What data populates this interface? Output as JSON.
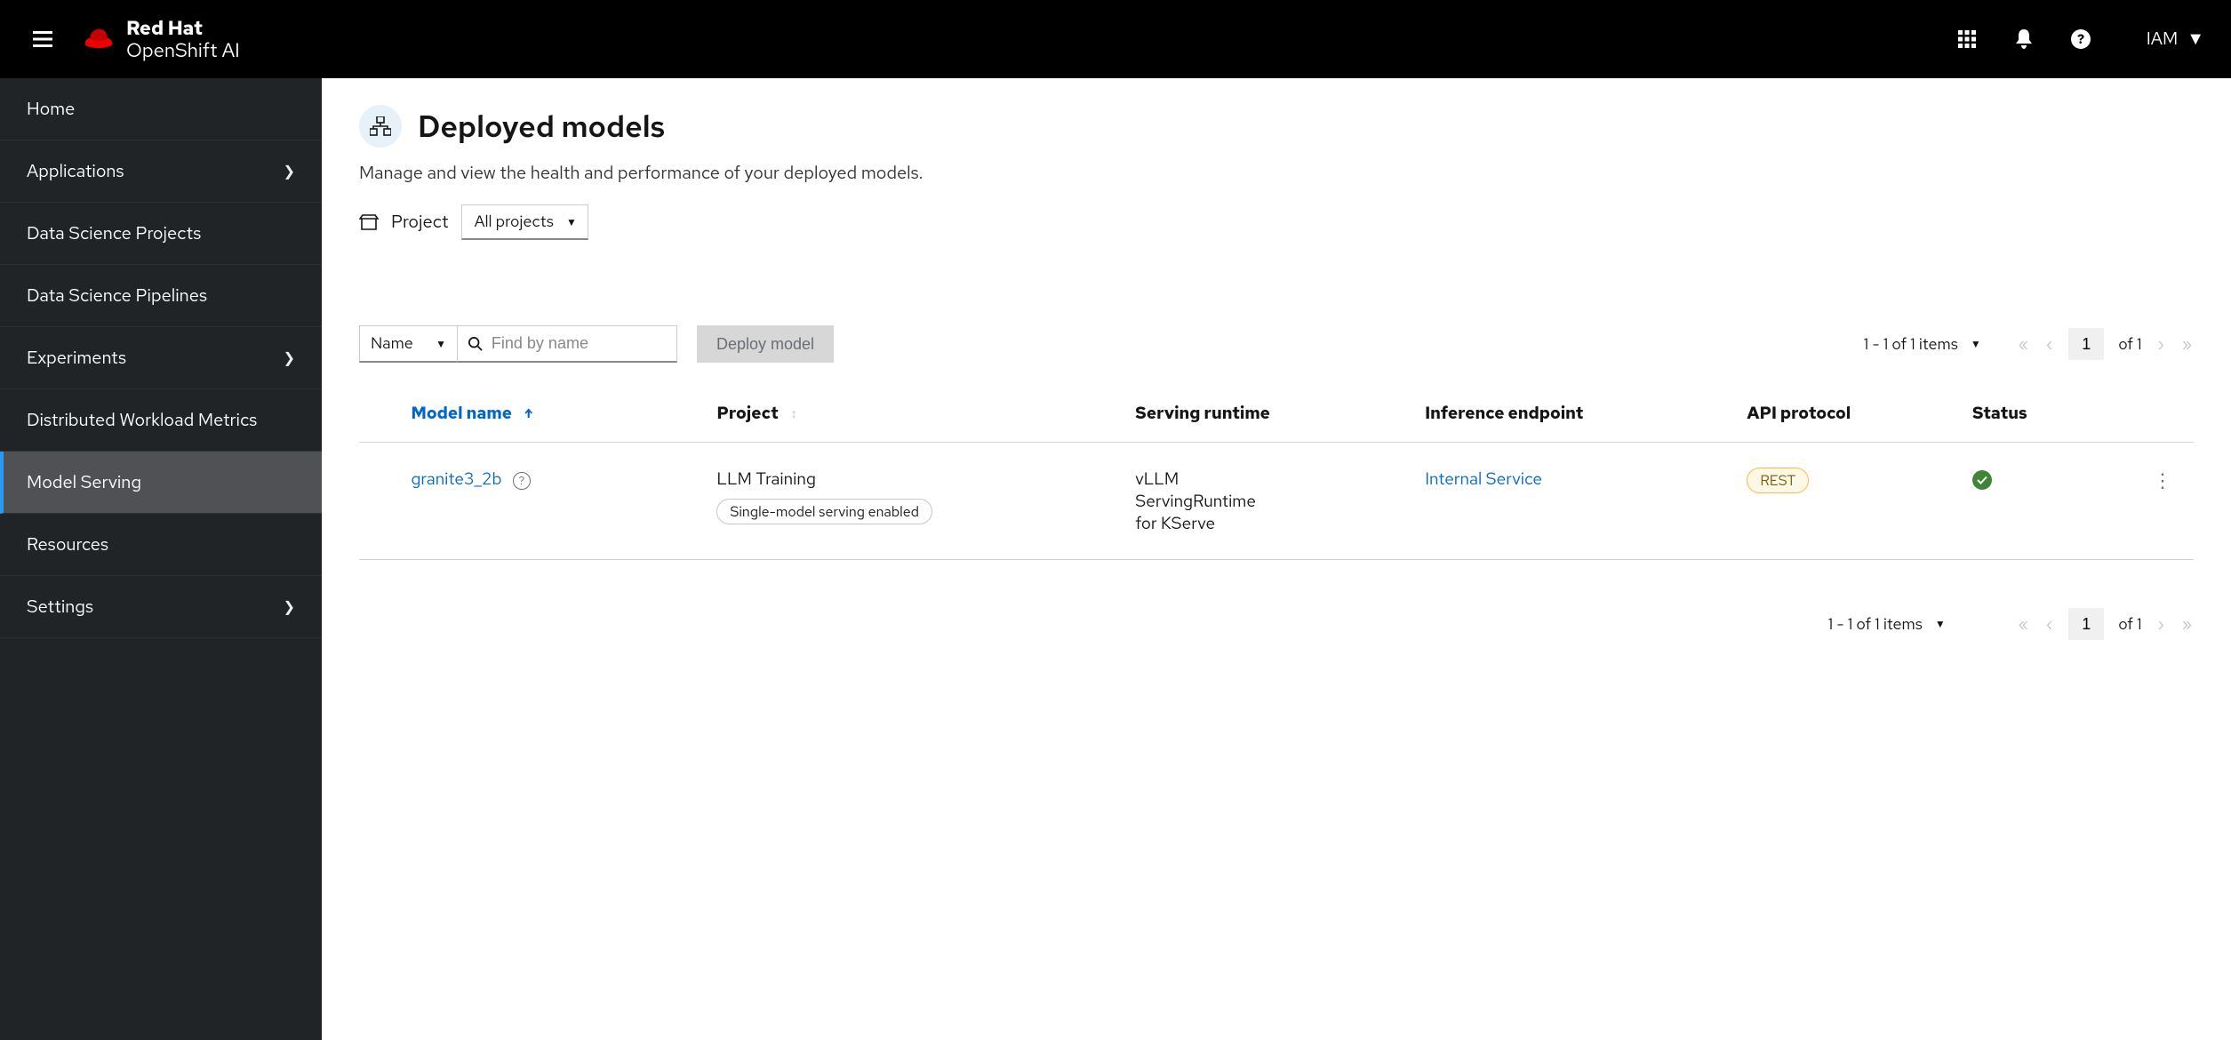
{
  "brand": {
    "top": "Red Hat",
    "bottom": "OpenShift AI"
  },
  "user": {
    "label": "IAM"
  },
  "sidebar": {
    "items": [
      {
        "label": "Home",
        "expandable": false
      },
      {
        "label": "Applications",
        "expandable": true
      },
      {
        "label": "Data Science Projects",
        "expandable": false
      },
      {
        "label": "Data Science Pipelines",
        "expandable": false
      },
      {
        "label": "Experiments",
        "expandable": true
      },
      {
        "label": "Distributed Workload Metrics",
        "expandable": false
      },
      {
        "label": "Model Serving",
        "expandable": false,
        "selected": true
      },
      {
        "label": "Resources",
        "expandable": false
      },
      {
        "label": "Settings",
        "expandable": true
      }
    ]
  },
  "page": {
    "title": "Deployed models",
    "description": "Manage and view the health and performance of your deployed models.",
    "project_label": "Project",
    "project_selected": "All projects"
  },
  "toolbar": {
    "filter_field": "Name",
    "search_placeholder": "Find by name",
    "deploy_label": "Deploy model",
    "items_text": "1 - 1 of 1 items",
    "page_number": "1",
    "of_text": "of 1"
  },
  "table": {
    "columns": {
      "model_name": "Model name",
      "project": "Project",
      "serving_runtime": "Serving runtime",
      "inference_endpoint": "Inference endpoint",
      "api_protocol": "API protocol",
      "status": "Status"
    },
    "rows": [
      {
        "model_name": "granite3_2b",
        "project": "LLM Training",
        "project_badge": "Single-model serving enabled",
        "serving_runtime": "vLLM ServingRuntime for KServe",
        "inference_endpoint": "Internal Service",
        "api_protocol": "REST",
        "status": "ok"
      }
    ]
  }
}
